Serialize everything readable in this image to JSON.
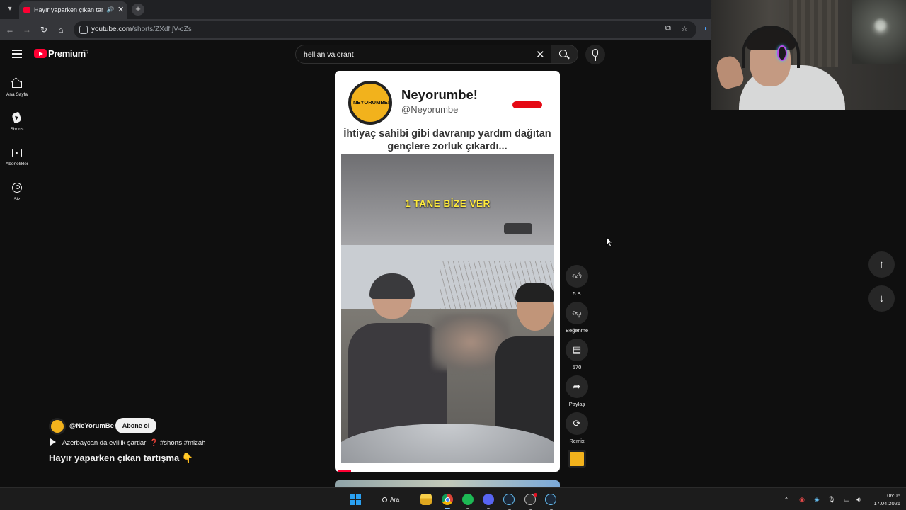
{
  "browser": {
    "tab_title": "Hayır yaparken çıkan tartışma",
    "url_host": "youtube.com",
    "url_path": "/shorts/ZXdfIjV-cZs"
  },
  "youtube": {
    "wordmark": "Premium",
    "region": "TR",
    "search_query": "hellian valorant"
  },
  "guide": [
    {
      "label": "Ana Sayfa",
      "icon": "home-icon"
    },
    {
      "label": "Shorts",
      "icon": "shorts-icon"
    },
    {
      "label": "Abonelikler",
      "icon": "subscriptions-icon"
    },
    {
      "label": "Siz",
      "icon": "you-icon"
    }
  ],
  "video": {
    "overlay_name": "Neyorumbe!",
    "overlay_handle": "@Neyorumbe",
    "overlay_logo_text": "NEYORUMBE!",
    "overlay_text": "İhtiyaç sahibi gibi davranıp yardım dağıtan gençlere zorluk çıkardı...",
    "caption": "1 TANE BİZE VER"
  },
  "actions": {
    "like_count": "5 B",
    "dislike_label": "Beğenme",
    "comment_count": "570",
    "share_label": "Paylaş",
    "remix_label": "Remix"
  },
  "meta": {
    "channel": "@NeYorumBe",
    "subscribe_label": "Abone ol",
    "music": "Azerbaycan da evlilik şartları ❓ #shorts #mizah",
    "title": "Hayır yaparken çıkan tartışma 👇"
  },
  "taskbar": {
    "search_label": "Ara",
    "time": "06:05",
    "date": "17.04.2026"
  },
  "colors": {
    "background": "#0f0f0f",
    "youtube_red": "#ff0033",
    "subscribe_bg": "#f1f1f1"
  }
}
